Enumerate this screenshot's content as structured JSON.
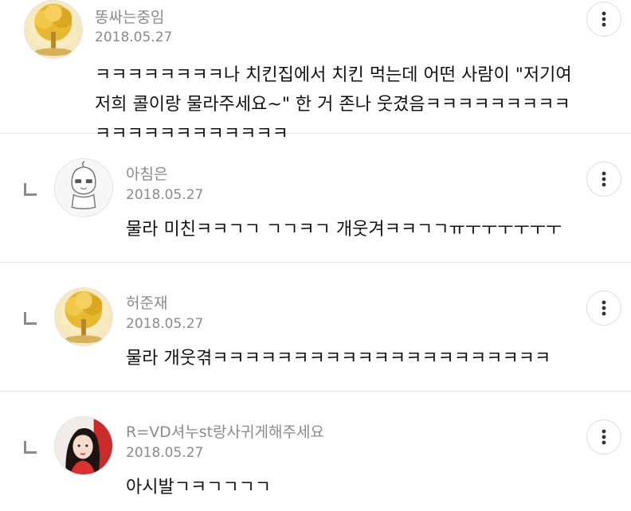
{
  "comments": [
    {
      "username": "똥싸는중임",
      "date": "2018.05.27",
      "text": "ㅋㅋㅋㅋㅋㅋㅋㅋ나 치킨집에서 치킨 먹는데 어떤 사람이 \"저기여 저희 콜이랑 물라주세요~\" 한 거 존나 웃겼음ㅋㅋㅋㅋㅋㅋㅋㅋㅋㅋㅋㅋㅋㅋㅋㅋㅋㅋㅋㅋㅋ",
      "avatar_icon": "golden-tree-avatar",
      "more_icon": "more-vertical-icon"
    },
    {
      "username": "아침은",
      "date": "2018.05.27",
      "text": "물라 미친ㅋㅋㄱㄱ ㄱㄱㅋㄱ 개웃겨ㅋㅋㄱㄱㅠㅜㅜㅜㅜㅜㅜ",
      "avatar_icon": "default-character-avatar",
      "more_icon": "more-vertical-icon"
    },
    {
      "username": "허준재",
      "date": "2018.05.27",
      "text": "물라 개웃겪ㅋㅋㅋㅋㅋㅋㅋㅋㅋㅋㅋㅋㅋㅋㅋㅋㅋㅋㅋㅋㅋ",
      "avatar_icon": "golden-tree-avatar",
      "more_icon": "more-vertical-icon"
    },
    {
      "username": "R=VD셔누st랑사귀게해주세요",
      "date": "2018.05.27",
      "text": "아시발ㄱㅋㄱㄱㄱㄱ",
      "avatar_icon": "profile-photo-avatar",
      "more_icon": "more-vertical-icon"
    }
  ],
  "colors": {
    "meta_text": "#8b8b8b",
    "body_text": "#111111",
    "divider": "#e4e4e4"
  }
}
